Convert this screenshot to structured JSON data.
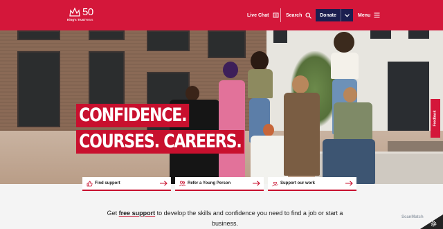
{
  "brand": {
    "org_name": "King's Trust",
    "anniversary_number": "50",
    "anniversary_word": "Years",
    "primary_color": "#d4173a",
    "navy_color": "#1b1e4f"
  },
  "nav": {
    "live_chat": "Live Chat",
    "search": "Search",
    "donate": "Donate",
    "menu": "Menu"
  },
  "hero": {
    "headline_line1": "CONFIDENCE.",
    "headline_line2": "COURSES. CAREERS.",
    "feedback": "Feedback"
  },
  "quick_links": [
    {
      "label": "Find support",
      "icon": "thumbs-up-icon"
    },
    {
      "label": "Refer a Young Person",
      "icon": "people-icon"
    },
    {
      "label": "Support our work",
      "icon": "hand-heart-icon"
    }
  ],
  "intro": {
    "before": "Get ",
    "link": "free support",
    "after": " to develop the skills and confidence you need to find a job or start a business."
  },
  "watermark": "ScanMatch"
}
